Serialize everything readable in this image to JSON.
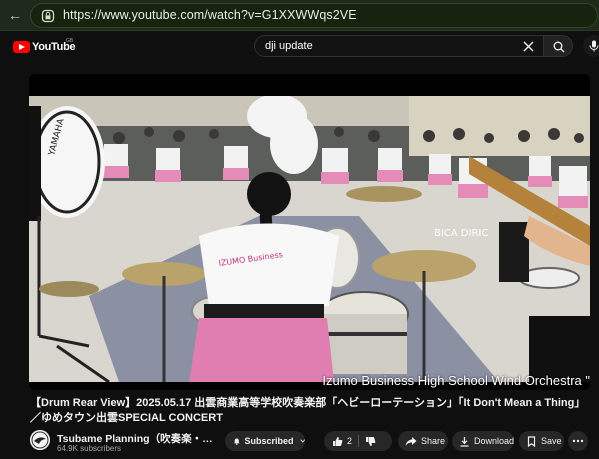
{
  "browser": {
    "url": "https://www.youtube.com/watch?v=G1XXWWqs2VE"
  },
  "header": {
    "logo_text": "YouTube",
    "region": "GB",
    "search_query": "dji update"
  },
  "player": {
    "caption": "Izumo Business High School Wind Orchestra \""
  },
  "video": {
    "title": "【Drum Rear View】2025.05.17 出雲商業高等学校吹奏楽部「ヘビーローテーション」「It Don't Mean a Thing」／ゆめタウン出雲SPECIAL CONCERT"
  },
  "channel": {
    "name": "Tsubame Planning（吹奏楽・マーチング）",
    "subscribers": "64.9K subscribers"
  },
  "actions": {
    "subscribed_label": "Subscribed",
    "like_count": "2",
    "share_label": "Share",
    "download_label": "Download",
    "save_label": "Save"
  },
  "icons": {
    "lock": "lock-icon",
    "clear": "close-icon",
    "search": "search-icon",
    "mic": "mic-icon",
    "bell": "bell-icon",
    "like": "thumbs-up-icon",
    "dislike": "thumbs-down-icon",
    "share": "share-icon",
    "download": "download-icon",
    "save": "save-icon",
    "more": "more-icon"
  },
  "colors": {
    "brand_red": "#ff0000",
    "background": "#0f0f0f",
    "pill": "#272727"
  }
}
